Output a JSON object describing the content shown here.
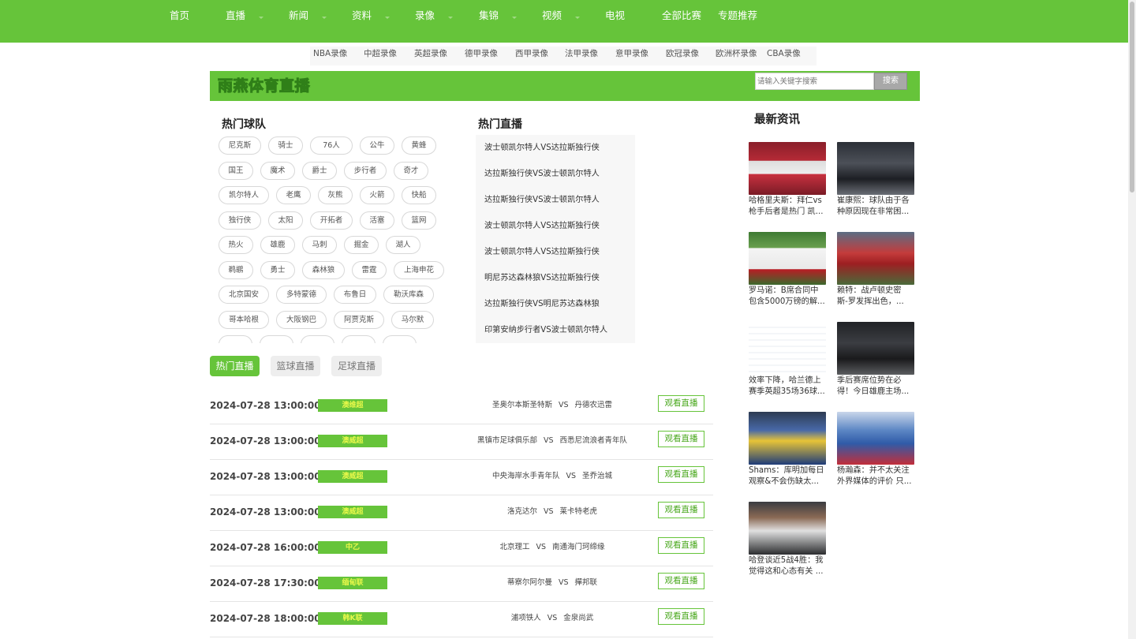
{
  "colors": {
    "brand_green": "#66c43a",
    "league_text": "#e8f84a",
    "search_button": "#a8a8a8"
  },
  "topnav": {
    "items": [
      {
        "label": "首页",
        "has_menu": false
      },
      {
        "label": "直播",
        "has_menu": true
      },
      {
        "label": "新闻",
        "has_menu": true
      },
      {
        "label": "资料",
        "has_menu": true
      },
      {
        "label": "录像",
        "has_menu": true
      },
      {
        "label": "集锦",
        "has_menu": true
      },
      {
        "label": "视频",
        "has_menu": true
      },
      {
        "label": "电视",
        "has_menu": false
      },
      {
        "label": "全部比赛",
        "has_menu": false
      },
      {
        "label": "专题推荐",
        "has_menu": false
      }
    ]
  },
  "subnav": [
    "NBA录像",
    "中超录像",
    "英超录像",
    "德甲录像",
    "西甲录像",
    "法甲录像",
    "意甲录像",
    "欧冠录像",
    "欧洲杯录像",
    "CBA录像"
  ],
  "banner": {
    "logo_text": "雨燕体育直播",
    "search_placeholder": "请输入关键字搜索",
    "search_button": "搜索"
  },
  "hot_teams": {
    "title": "热门球队",
    "rows": [
      [
        "尼克斯",
        "骑士",
        "76人",
        "公牛",
        "黄蜂"
      ],
      [
        "国王",
        "魔术",
        "爵士",
        "步行者",
        "奇才"
      ],
      [
        "凯尔特人",
        "老鹰",
        "灰熊",
        "火箭",
        "快船"
      ],
      [
        "独行侠",
        "太阳",
        "开拓者",
        "活塞",
        "篮网"
      ],
      [
        "热火",
        "雄鹿",
        "马刺",
        "掘金",
        "湖人"
      ],
      [
        "鹈鹕",
        "勇士",
        "森林狼",
        "雷霆",
        "上海申花"
      ],
      [
        "北京国安",
        "多特蒙德",
        "布鲁日",
        "勒沃库森"
      ],
      [
        "哥本哈根",
        "大阪钢巴",
        "阿贾克斯",
        "马尔默"
      ]
    ]
  },
  "hot_live": {
    "title": "热门直播",
    "items": [
      "波士顿凯尔特人VS达拉斯独行侠",
      "达拉斯独行侠VS波士顿凯尔特人",
      "达拉斯独行侠VS波士顿凯尔特人",
      "波士顿凯尔特人VS达拉斯独行侠",
      "波士顿凯尔特人VS达拉斯独行侠",
      "明尼苏达森林狼VS达拉斯独行侠",
      "达拉斯独行侠VS明尼苏达森林狼",
      "印第安纳步行者VS波士顿凯尔特人"
    ]
  },
  "schedule": {
    "tabs": [
      "热门直播",
      "篮球直播",
      "足球直播"
    ],
    "active_tab": 0,
    "matches": [
      {
        "time": "2024-07-28 13:00:00",
        "league": "澳维超",
        "home": "圣奥尔本斯圣特斯",
        "vs": "VS",
        "away": "丹德农迅雷",
        "action": "观看直播"
      },
      {
        "time": "2024-07-28 13:00:00",
        "league": "澳威超",
        "home": "黑镇市足球俱乐部",
        "vs": "VS",
        "away": "西悉尼流浪者青年队",
        "action": "观看直播"
      },
      {
        "time": "2024-07-28 13:00:00",
        "league": "澳威超",
        "home": "中央海岸水手青年队",
        "vs": "VS",
        "away": "圣乔治城",
        "action": "观看直播"
      },
      {
        "time": "2024-07-28 13:00:00",
        "league": "澳威超",
        "home": "洛克达尔",
        "vs": "VS",
        "away": "莱卡特老虎",
        "action": "观看直播"
      },
      {
        "time": "2024-07-28 16:00:00",
        "league": "中乙",
        "home": "北京理工",
        "vs": "VS",
        "away": "南通海门珂缔缘",
        "action": "观看直播"
      },
      {
        "time": "2024-07-28 17:30:00",
        "league": "缅甸联",
        "home": "蒂察尔阿尔曼",
        "vs": "VS",
        "away": "撣邦联",
        "action": "观看直播"
      },
      {
        "time": "2024-07-28 18:00:00",
        "league": "韩K联",
        "home": "浦项铁人",
        "vs": "VS",
        "away": "金泉尚武",
        "action": "观看直播"
      }
    ]
  },
  "news": {
    "title": "最新资讯",
    "items": [
      {
        "line1": "哈格里夫斯：拜仁vs",
        "line2": "枪手后者是热门 凯..."
      },
      {
        "line1": "崔康熙：球队由于各",
        "line2": "种原因现在非常困..."
      },
      {
        "line1": "罗马诺：B席合同中",
        "line2": "包含5000万镑的解..."
      },
      {
        "line1": "赖特：战卢顿史密",
        "line2": "斯-罗发挥出色，..."
      },
      {
        "line1": "效率下降，哈兰德上",
        "line2": "赛季英超35场36球..."
      },
      {
        "line1": "季后赛席位势在必",
        "line2": "得！今日雄鹿主场..."
      },
      {
        "line1": "Shams：库明加每日",
        "line2": "观察&不会伤缺太..."
      },
      {
        "line1": "杨瀚森：并不太关注",
        "line2": "外界媒体的评价 只..."
      },
      {
        "line1": "哈登谈近5战4胜：我",
        "line2": "觉得这和心态有关 ..."
      }
    ]
  }
}
